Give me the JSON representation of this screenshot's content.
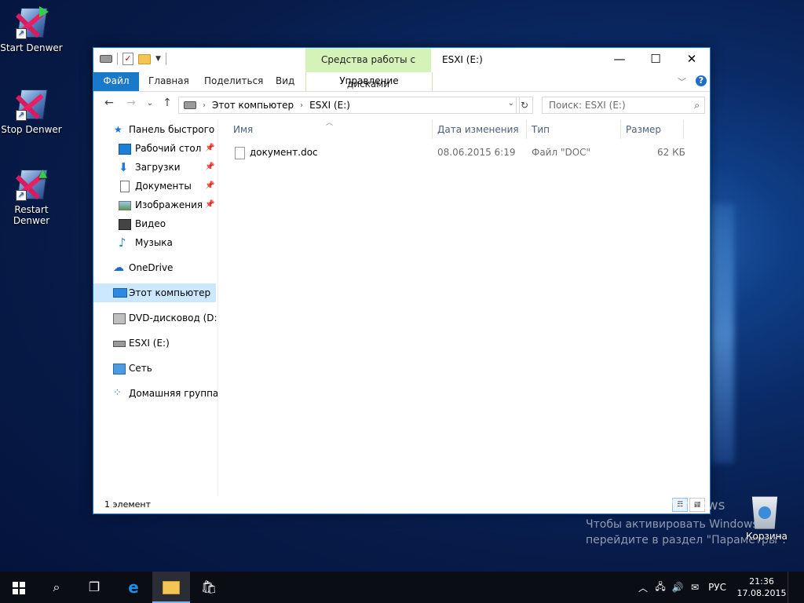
{
  "desktop": {
    "icons": [
      {
        "label": "Start Denwer"
      },
      {
        "label": "Stop Denwer"
      },
      {
        "label": "Restart Denwer"
      }
    ],
    "recycle_bin": "Корзина",
    "activation": {
      "title": "Активация Windows",
      "line1": "Чтобы активировать Windows,",
      "line2": "перейдите в раздел \"Параметры\"."
    }
  },
  "window": {
    "title": "ESXI (E:)",
    "context_tab": "Средства работы с дисками",
    "context_subtab": "Управление",
    "ribbon_tabs": [
      "Файл",
      "Главная",
      "Поделиться",
      "Вид"
    ],
    "address": {
      "crumbs": [
        "Этот компьютер",
        "ESXI (E:)"
      ]
    },
    "search_placeholder": "Поиск: ESXI (E:)",
    "nav": [
      {
        "label": "Панель быстрого доступа",
        "icon": "star-icon"
      },
      {
        "label": "Рабочий стол",
        "icon": "desktop-icon",
        "pinned": true
      },
      {
        "label": "Загрузки",
        "icon": "download-icon",
        "pinned": true
      },
      {
        "label": "Документы",
        "icon": "documents-icon",
        "pinned": true
      },
      {
        "label": "Изображения",
        "icon": "pictures-icon",
        "pinned": true
      },
      {
        "label": "Видео",
        "icon": "video-icon"
      },
      {
        "label": "Музыка",
        "icon": "music-icon"
      },
      {
        "label": "OneDrive",
        "icon": "cloud-icon"
      },
      {
        "label": "Этот компьютер",
        "icon": "computer-icon",
        "selected": true
      },
      {
        "label": "DVD-дисковод (D:) J_",
        "icon": "dvd-icon"
      },
      {
        "label": "ESXI (E:)",
        "icon": "drive-icon"
      },
      {
        "label": "Сеть",
        "icon": "network-icon"
      },
      {
        "label": "Домашняя группа",
        "icon": "homegroup-icon"
      }
    ],
    "columns": [
      "Имя",
      "Дата изменения",
      "Тип",
      "Размер"
    ],
    "files": [
      {
        "name": "документ.doc",
        "modified": "08.06.2015 6:19",
        "type": "Файл \"DOC\"",
        "size": "62 КБ"
      }
    ],
    "status": "1 элемент"
  },
  "taskbar": {
    "lang": "РУС",
    "time": "21:36",
    "date": "17.08.2015"
  },
  "colors": {
    "accent": "#1979ca",
    "context_tab_bg": "#d5f2b8",
    "selected_bg": "#cce8ff"
  }
}
